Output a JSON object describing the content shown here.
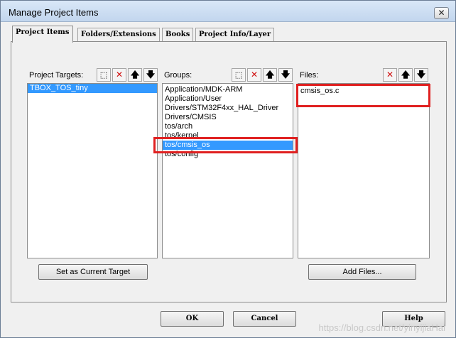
{
  "window": {
    "title": "Manage Project Items",
    "close_glyph": "✕"
  },
  "tabs": [
    {
      "label": "Project Items",
      "active": true
    },
    {
      "label": "Folders/Extensions",
      "active": false
    },
    {
      "label": "Books",
      "active": false
    },
    {
      "label": "Project Info/Layer",
      "active": false
    }
  ],
  "targets": {
    "caption": "Project Targets:",
    "items": [
      "TBOX_TOS_tiny"
    ],
    "selected_index": 0,
    "set_current_button": "Set as Current Target"
  },
  "groups": {
    "caption": "Groups:",
    "items": [
      "Application/MDK-ARM",
      "Application/User",
      "Drivers/STM32F4xx_HAL_Driver",
      "Drivers/CMSIS",
      "tos/arch",
      "tos/kernel",
      "tos/cmsis_os",
      "tos/config"
    ],
    "selected_index": 6
  },
  "files": {
    "caption": "Files:",
    "items": [
      "cmsis_os.c"
    ],
    "add_button": "Add Files..."
  },
  "toolbar_icons": {
    "new": "new-item-icon",
    "delete": "delete-icon",
    "up": "move-up-icon",
    "down": "move-down-icon",
    "glyphs": {
      "new": "⬚",
      "delete": "✕",
      "up": "🡅",
      "down": "🡇"
    }
  },
  "buttons": {
    "ok": "OK",
    "cancel": "Cancel",
    "help": "Help"
  },
  "watermark": "https://blog.csdn.net/yinyijiaHai",
  "colors": {
    "selection": "#3399ff",
    "annotation": "#e02020",
    "delete_icon": "#d01010"
  }
}
